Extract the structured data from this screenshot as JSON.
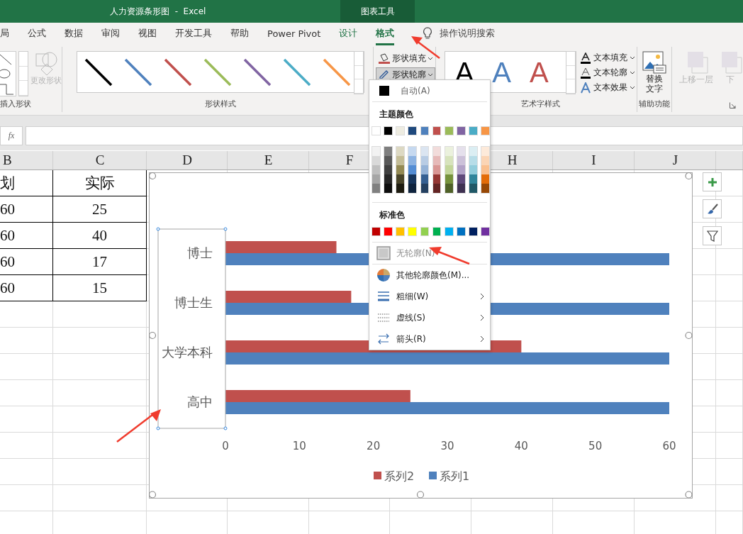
{
  "title_bar": {
    "title": "人力资源条形图  -  Excel",
    "context_label": "图表工具"
  },
  "tabs": [
    {
      "label": "局",
      "selected": false,
      "contextual": false
    },
    {
      "label": "公式",
      "selected": false,
      "contextual": false
    },
    {
      "label": "数据",
      "selected": false,
      "contextual": false
    },
    {
      "label": "审阅",
      "selected": false,
      "contextual": false
    },
    {
      "label": "视图",
      "selected": false,
      "contextual": false
    },
    {
      "label": "开发工具",
      "selected": false,
      "contextual": false
    },
    {
      "label": "帮助",
      "selected": false,
      "contextual": false
    },
    {
      "label": "Power Pivot",
      "selected": false,
      "contextual": false
    },
    {
      "label": "设计",
      "selected": false,
      "contextual": true
    },
    {
      "label": "格式",
      "selected": true,
      "contextual": true
    }
  ],
  "tell_me": "操作说明搜索",
  "ribbon": {
    "insert_shapes": {
      "change_shape": {
        "label": "更改形状",
        "disabled": true
      },
      "label": "插入形状"
    },
    "shape_styles": {
      "swatches": [
        {
          "color": "#000000"
        },
        {
          "color": "#4f81bd"
        },
        {
          "color": "#c0504d"
        },
        {
          "color": "#9bbb59"
        },
        {
          "color": "#8064a2"
        },
        {
          "color": "#4bacc6"
        },
        {
          "color": "#f79646"
        }
      ],
      "label": "形状样式"
    },
    "shape_commands": [
      {
        "label": "形状填充",
        "pressed": false
      },
      {
        "label": "形状轮廓",
        "pressed": true
      }
    ],
    "wordart": {
      "samples": [
        {
          "letter": "A",
          "color": "#000000"
        },
        {
          "letter": "A",
          "color": "#4f81bd"
        },
        {
          "letter": "A",
          "color": "#c0504d"
        }
      ],
      "commands": [
        {
          "kind": "fill",
          "label": "文本填充"
        },
        {
          "kind": "outline",
          "label": "文本轮廓"
        },
        {
          "kind": "effects",
          "label": "文本效果"
        }
      ],
      "label": "艺术字样式"
    },
    "accessibility": {
      "button": [
        "替换",
        "文字"
      ],
      "label": "辅助功能"
    },
    "arrange": [
      {
        "label": "上移一层",
        "disabled": true
      },
      {
        "label": "下",
        "disabled": true
      }
    ]
  },
  "formula_bar": {
    "function_button": "fx"
  },
  "sheet": {
    "columns": [
      {
        "label": "B"
      },
      {
        "label": "C"
      },
      {
        "label": "D"
      },
      {
        "label": "E"
      },
      {
        "label": "F"
      },
      {},
      {
        "label": "H"
      },
      {
        "label": "I"
      },
      {
        "label": "J"
      },
      {}
    ],
    "rows": [
      [
        "划",
        "实际"
      ],
      [
        "60",
        "25"
      ],
      [
        "60",
        "40"
      ],
      [
        "60",
        "17"
      ],
      [
        "60",
        "15"
      ]
    ]
  },
  "chart": {
    "axis_selected": true,
    "chart_data": {
      "type": "bar",
      "orientation": "horizontal",
      "categories": [
        "博士",
        "博士生",
        "大学本科",
        "高中"
      ],
      "series": [
        {
          "name": "系列2",
          "color": "#c0504d",
          "values": [
            15,
            17,
            40,
            25
          ]
        },
        {
          "name": "系列1",
          "color": "#4f81bd",
          "values": [
            60,
            60,
            60,
            60
          ]
        }
      ],
      "xlim": [
        0,
        60
      ],
      "xticks": [
        0,
        10,
        20,
        30,
        40,
        50,
        60
      ],
      "legend": "bottom"
    }
  },
  "outline_menu": {
    "auto": {
      "label": "自动(A)",
      "color": "#000000"
    },
    "theme_title": "主题颜色",
    "theme_colors": [
      {
        "color": "#ffffff",
        "shades": [
          {
            "color": "#f2f2f2"
          },
          {
            "color": "#d9d9d9"
          },
          {
            "color": "#bfbfbf"
          },
          {
            "color": "#a6a6a6"
          },
          {
            "color": "#808080"
          }
        ]
      },
      {
        "color": "#000000",
        "shades": [
          {
            "color": "#7f7f7f"
          },
          {
            "color": "#595959"
          },
          {
            "color": "#404040"
          },
          {
            "color": "#262626"
          },
          {
            "color": "#0d0d0d"
          }
        ]
      },
      {
        "color": "#eeece1",
        "shades": [
          {
            "color": "#ddd9c3"
          },
          {
            "color": "#c4bd97"
          },
          {
            "color": "#948a54"
          },
          {
            "color": "#4a452a"
          },
          {
            "color": "#1e1c11"
          }
        ]
      },
      {
        "color": "#1f497d",
        "shades": [
          {
            "color": "#c6d9f0"
          },
          {
            "color": "#8db3e2"
          },
          {
            "color": "#548dd4"
          },
          {
            "color": "#17365d"
          },
          {
            "color": "#0f243e"
          }
        ]
      },
      {
        "color": "#4f81bd",
        "shades": [
          {
            "color": "#dbe5f1"
          },
          {
            "color": "#b8cce4"
          },
          {
            "color": "#95b3d7"
          },
          {
            "color": "#366092"
          },
          {
            "color": "#244061"
          }
        ]
      },
      {
        "color": "#c0504d",
        "shades": [
          {
            "color": "#f2dcdb"
          },
          {
            "color": "#e6b9b8"
          },
          {
            "color": "#d99694"
          },
          {
            "color": "#953734"
          },
          {
            "color": "#632423"
          }
        ]
      },
      {
        "color": "#9bbb59",
        "shades": [
          {
            "color": "#ebf1dd"
          },
          {
            "color": "#d7e3bc"
          },
          {
            "color": "#c3d69b"
          },
          {
            "color": "#76923c"
          },
          {
            "color": "#4f6128"
          }
        ]
      },
      {
        "color": "#8064a2",
        "shades": [
          {
            "color": "#e5e0ec"
          },
          {
            "color": "#ccc1d9"
          },
          {
            "color": "#b2a2c7"
          },
          {
            "color": "#5f497a"
          },
          {
            "color": "#3f3151"
          }
        ]
      },
      {
        "color": "#4bacc6",
        "shades": [
          {
            "color": "#dbeef3"
          },
          {
            "color": "#b7dde8"
          },
          {
            "color": "#92cddc"
          },
          {
            "color": "#31859b"
          },
          {
            "color": "#205867"
          }
        ]
      },
      {
        "color": "#f79646",
        "shades": [
          {
            "color": "#fdeada"
          },
          {
            "color": "#fbd5b5"
          },
          {
            "color": "#fac08f"
          },
          {
            "color": "#e36c09"
          },
          {
            "color": "#974806"
          }
        ]
      }
    ],
    "standard_title": "标准色",
    "standard_colors": [
      {
        "color": "#c00000"
      },
      {
        "color": "#ff0000"
      },
      {
        "color": "#ffc000"
      },
      {
        "color": "#ffff00"
      },
      {
        "color": "#92d050"
      },
      {
        "color": "#00b050"
      },
      {
        "color": "#00b0f0"
      },
      {
        "color": "#0070c0"
      },
      {
        "color": "#002060"
      },
      {
        "color": "#7030a0"
      }
    ],
    "items": [
      {
        "kind": "none",
        "label": "无轮廓(N)",
        "disabled": true,
        "submenu": false
      },
      {
        "kind": "more",
        "label": "其他轮廓颜色(M)...",
        "disabled": false,
        "submenu": false
      },
      {
        "kind": "weight",
        "label": "粗细(W)",
        "disabled": false,
        "submenu": true
      },
      {
        "kind": "dash",
        "label": "虚线(S)",
        "disabled": false,
        "submenu": true
      },
      {
        "kind": "arrow",
        "label": "箭头(R)",
        "disabled": false,
        "submenu": true
      }
    ]
  }
}
